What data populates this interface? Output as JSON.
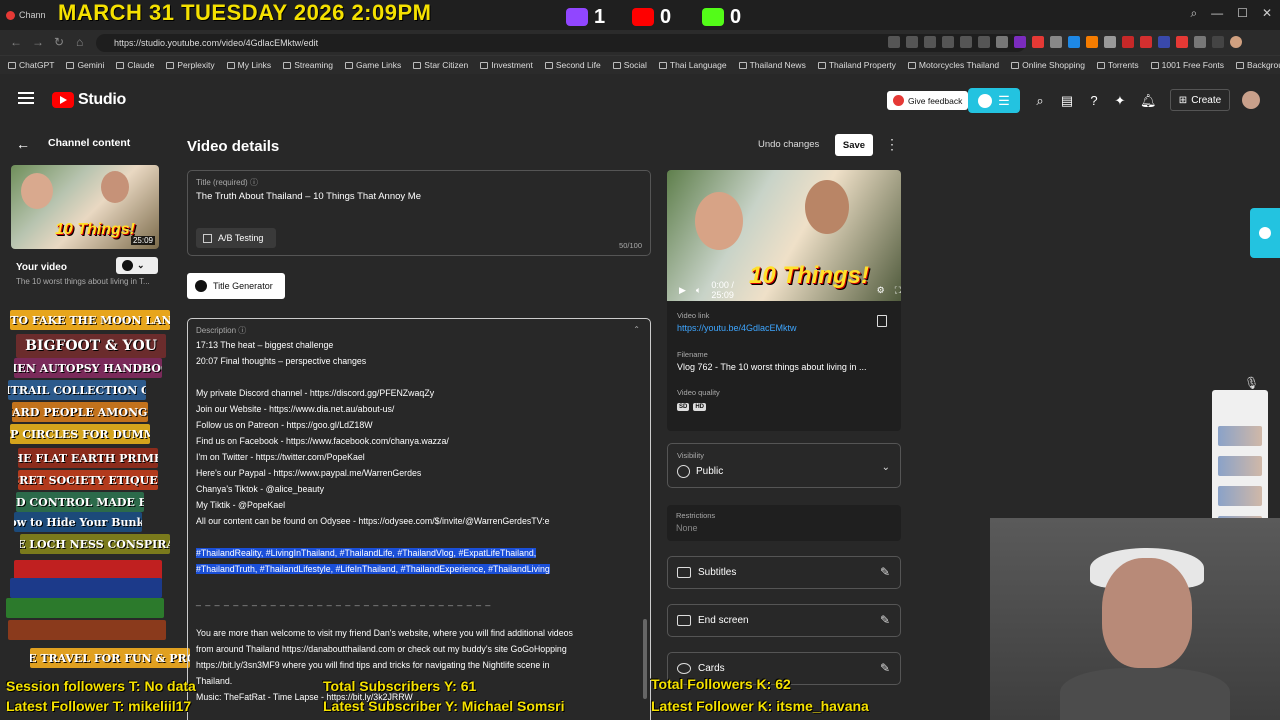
{
  "overlay": {
    "date_banner": "MARCH 31 TUESDAY 2026 2:09PM",
    "twitch_count": "1",
    "youtube_count": "0",
    "kick_count": "0",
    "session_followers": "Session followers T: No data",
    "latest_follower_t": "Latest Follower T: mikeliil17",
    "total_subscribers": "Total Subscribers Y: 61",
    "latest_subscriber": "Latest Subscriber Y: Michael Somsri",
    "total_followers_k": "Total Followers K: 62",
    "latest_follower_k": "Latest Follower K: itsme_havana"
  },
  "browser": {
    "tab_title": "Chann",
    "url": "https://studio.youtube.com/video/4GdlacEMktw/edit",
    "bookmarks": [
      "ChatGPT",
      "Gemini",
      "Claude",
      "Perplexity",
      "My Links",
      "Streaming",
      "Game Links",
      "Star Citizen",
      "Investment",
      "Second Life",
      "Social",
      "Thai Language",
      "Thailand News",
      "Thailand Property",
      "Motorcycles Thailand",
      "Online Shopping",
      "Torrents",
      "1001 Free Fonts",
      "Background Remover"
    ]
  },
  "studio": {
    "logo_text": "Studio",
    "feedback_label": "Give feedback",
    "create_label": "Create"
  },
  "sidebar": {
    "back_label": "Channel content",
    "thumb_title": "10 Things!",
    "thumb_duration": "25:09",
    "your_video": "Your video",
    "video_subtitle": "The 10 worst things about living in T..."
  },
  "books": [
    "HOW TO FAKE THE MOON LANDING",
    "BIGFOOT & YOU",
    "ALIEN AUTOPSY HANDBOOK",
    "CHEMTRAIL COLLECTION GUIDE",
    "LIZARD PEOPLE AMONG US",
    "CROP CIRCLES FOR DUMMIES",
    "THE FLAT EARTH PRIMER",
    "SECRET SOCIETY ETIQUETTE",
    "MIND CONTROL MADE EASY",
    "How to Hide Your Bunker",
    "THE LOCH NESS CONSPIRACY",
    "",
    "",
    "",
    "",
    "TIME TRAVEL FOR FUN & PROFIT"
  ],
  "details": {
    "heading": "Video details",
    "undo_label": "Undo changes",
    "save_label": "Save",
    "title_label": "Title (required)",
    "title_value": "The Truth About Thailand – 10 Things That Annoy Me",
    "ab_label": "A/B Testing",
    "char_count": "50/100",
    "title_gen_label": "Title Generator",
    "description_label": "Description",
    "description_lines": [
      "17:13 The heat – biggest challenge",
      "20:07 Final thoughts – perspective changes",
      "",
      "My private Discord channel - https://discord.gg/PFENZwaqZy",
      "Join our Website - https://www.dia.net.au/about-us/",
      "Follow us on Patreon - https://goo.gl/LdZ18W",
      "Find us on Facebook - https://www.facebook.com/chanya.wazza/",
      "I'm on Twitter - https://twitter.com/PopeKael",
      "Here's our Paypal - https://www.paypal.me/WarrenGerdes",
      "Chanya's Tiktok - @alice_beauty",
      "My Tiktik - @PopeKael",
      "All our content can be found on Odysee - https://odysee.com/$/invite/@WarrenGerdesTV:e",
      "",
      "#ThailandReality, #LivingInThailand, #ThailandLife, #ThailandVlog, #ExpatLifeThailand,",
      "#ThailandTruth, #ThailandLifestyle, #LifeInThailand, #ThailandExperience, #ThailandLiving",
      "",
      "_ _ _ _ _ _ _ _ _ _ _ _ _ _ _ _ _ _ _ _ _ _ _ _ _ _ _ _ _ _ _ _",
      "",
      "You are more than welcome to visit my friend Dan's website, where you will find additional videos",
      "from around Thailand https://danaboutthailand.com or check out my buddy's site GoGoHopping",
      "https://bit.ly/3sn3MF9 where you will find tips and tricks for navigating the Nightlife scene in",
      "Thailand.",
      "Music: TheFatRat - Time Lapse - https://bit.ly/3k2JRRW"
    ]
  },
  "right": {
    "player_title": "10 Things!",
    "player_time": "0:00 / 25:09",
    "video_link_label": "Video link",
    "video_link": "https://youtu.be/4GdlacEMktw",
    "filename_label": "Filename",
    "filename": "Vlog 762 - The 10 worst things about living in ...",
    "quality_label": "Video quality",
    "quality_sd": "SD",
    "quality_hd": "HD",
    "visibility_label": "Visibility",
    "visibility_value": "Public",
    "restrictions_label": "Restrictions",
    "restrictions_value": "None",
    "subtitles_label": "Subtitles",
    "end_screen_label": "End screen",
    "cards_label": "Cards"
  }
}
